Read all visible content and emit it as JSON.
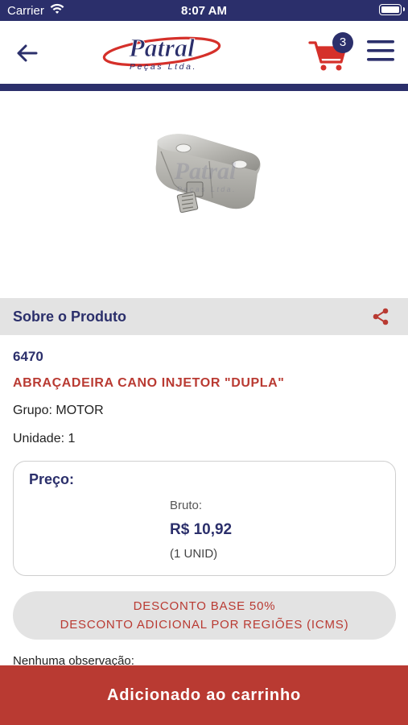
{
  "status_bar": {
    "carrier": "Carrier",
    "time": "8:07 AM",
    "wifi_icon": "wifi-icon",
    "battery_icon": "battery-icon"
  },
  "header": {
    "logo_text": "Patral",
    "logo_sub": "Peças Ltda.",
    "cart_count": "3",
    "icons": {
      "back": "arrow-left-icon",
      "cart": "shopping-cart-icon",
      "menu": "hamburger-menu-icon"
    }
  },
  "product_image": {
    "description_icon": "product-photo",
    "watermark": "Patral"
  },
  "section": {
    "title": "Sobre o Produto",
    "share_icon": "share-icon"
  },
  "product": {
    "code": "6470",
    "name": "ABRAÇADEIRA CANO INJETOR \"DUPLA\"",
    "group_label": "Grupo:",
    "group_value": "MOTOR",
    "unit_label": "Unidade:",
    "unit_value": "1"
  },
  "price": {
    "title": "Preço:",
    "bruto_label": "Bruto:",
    "value": "R$ 10,92",
    "unit": "(1 UNID)"
  },
  "discount": {
    "line1": "DESCONTO BASE 50%",
    "line2": "DESCONTO ADICIONAL POR REGIÕES (ICMS)"
  },
  "observation": "Nenhuma observação:",
  "add_to_cart": {
    "label": "Adicionado ao carrinho"
  },
  "colors": {
    "navy": "#2b2f6b",
    "red": "#b93a32",
    "section_gray": "#e3e3e3"
  }
}
